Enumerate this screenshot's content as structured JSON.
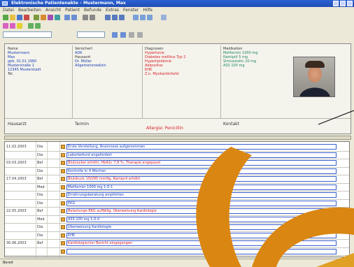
{
  "titlebar": {
    "title": "Elektronische Patientenakte – Mustermann, Max"
  },
  "menu": [
    "Datei",
    "Bearbeiten",
    "Ansicht",
    "Patient",
    "Befunde",
    "Extras",
    "Fenster",
    "Hilfe"
  ],
  "patient": {
    "col1": [
      "Name",
      "Mustermann",
      "Max",
      "geb. 01.01.1960",
      "Musterstraße 1",
      "12345 Musterstadt",
      "Tel."
    ],
    "col2": [
      "Versichert",
      "AOK",
      "Hausarzt",
      "Dr. Müller",
      "Allgemeinmedizin"
    ],
    "diagnoses_title": "Diagnosen",
    "diagnoses": [
      "Hypertonie",
      "Diabetes mellitus Typ 2",
      "Hyperlipidämie",
      "Adipositas",
      "KHK",
      "Z.n. Myokardinfarkt"
    ],
    "meds_title": "Medikation",
    "meds": [
      "Metformin 1000 mg",
      "Ramipril 5 mg",
      "Simvastatin 20 mg",
      "ASS 100 mg"
    ],
    "alert": "Allergie: Penicillin",
    "footer": [
      "Hausarzt",
      "Termin",
      "Kontakt"
    ]
  },
  "entries": [
    {
      "date": "11.02.2003",
      "type": "Dia",
      "text": "Erste Vorstellung, Anamnese aufgenommen",
      "color": "#1a3fb5"
    },
    {
      "date": "",
      "type": "Dia",
      "text": "Laborbefund angefordert",
      "color": "#1a3fb5"
    },
    {
      "date": "03.03.2003",
      "type": "Bef",
      "text": "Blutzucker erhöht, HbA1c 7,8 %, Therapie angepasst",
      "color": "#d8222a"
    },
    {
      "date": "",
      "type": "Dia",
      "text": "Kontrolle in 4 Wochen",
      "color": "#1a3fb5"
    },
    {
      "date": "17.04.2003",
      "type": "Bef",
      "text": "Blutdruck 150/95 mmHg, Ramipril erhöht",
      "color": "#d8222a"
    },
    {
      "date": "",
      "type": "Med",
      "text": "Metformin 1000 mg 1-0-1",
      "color": "#1a3fb5"
    },
    {
      "date": "",
      "type": "Dia",
      "text": "Ernährungsberatung empfohlen",
      "color": "#1a3fb5"
    },
    {
      "date": "",
      "type": "Dia",
      "text": "EKG",
      "color": "#1a3fb5"
    },
    {
      "date": "22.05.2003",
      "type": "Bef",
      "text": "Belastungs-EKG auffällig, Überweisung Kardiologie",
      "color": "#d8222a"
    },
    {
      "date": "",
      "type": "Med",
      "text": "ASS 100 mg 1-0-0",
      "color": "#1a3fb5"
    },
    {
      "date": "",
      "type": "Dia",
      "text": "Überweisung Kardiologie",
      "color": "#1a3fb5"
    },
    {
      "date": "",
      "type": "Dia",
      "text": "KHK",
      "color": "#1a3fb5"
    },
    {
      "date": "30.06.2003",
      "type": "Bef",
      "text": "Kardiologischer Bericht eingegangen",
      "color": "#d8222a"
    },
    {
      "date": "",
      "type": "",
      "text": "",
      "color": "#1a3fb5"
    }
  ],
  "status": "Bereit"
}
